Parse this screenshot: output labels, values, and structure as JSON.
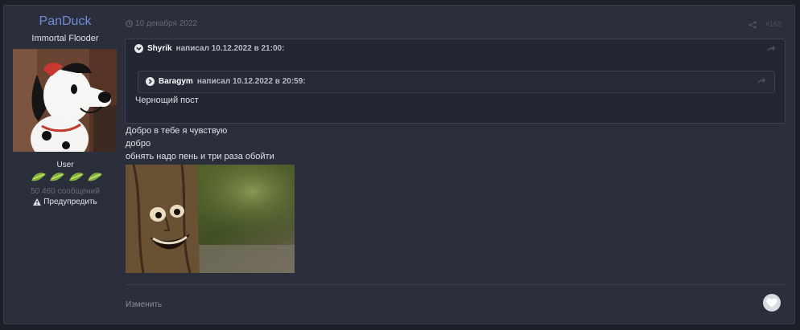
{
  "author": {
    "name": "PanDuck",
    "title": "Immortal Flooder",
    "group": "User",
    "posts_count": "50 460 сообщений",
    "warn_label": "Предупредить"
  },
  "post": {
    "date": "10 декабря 2022",
    "number": "#163",
    "quote_outer": {
      "author": "Shyrik",
      "wrote": "написал 10.12.2022 в 21:00:"
    },
    "quote_inner": {
      "author": "Baragym",
      "wrote": "написал 10.12.2022 в 20:59:",
      "text": "Чернощий пост"
    },
    "lines": [
      "Добро в тебе я чувствую",
      "добро",
      "обнять надо пень и три раза обойти"
    ],
    "edit_label": "Изменить"
  },
  "colors": {
    "accent_name": "#6f8cd9",
    "background": "#1d2029",
    "panel": "#2b2f3b"
  },
  "icons": [
    "clock-icon",
    "share-icon",
    "chevron-down-icon",
    "chevron-right-icon",
    "reply-arrow-icon",
    "warning-icon",
    "heart-icon",
    "cucumber-badge-icon"
  ]
}
